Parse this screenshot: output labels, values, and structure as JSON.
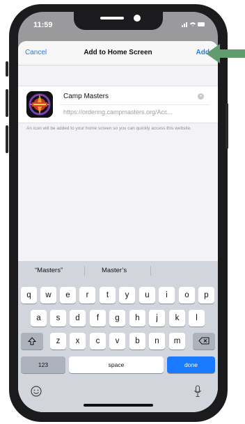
{
  "status": {
    "time": "11:59"
  },
  "nav": {
    "cancel": "Cancel",
    "title": "Add to Home Screen",
    "add": "Add"
  },
  "bookmark": {
    "name": "Camp Masters",
    "url": "https://ordering.campmasters.org/Acc...",
    "note": "An icon will be added to your home screen so you can quickly access this website."
  },
  "keyboard": {
    "suggestions": [
      "“Masters”",
      "Master’s"
    ],
    "row1": [
      "q",
      "w",
      "e",
      "r",
      "t",
      "y",
      "u",
      "i",
      "o",
      "p"
    ],
    "row2": [
      "a",
      "s",
      "d",
      "f",
      "g",
      "h",
      "j",
      "k",
      "l"
    ],
    "row3": [
      "z",
      "x",
      "c",
      "v",
      "b",
      "n",
      "m"
    ],
    "numbers": "123",
    "space": "space",
    "done": "done"
  },
  "colors": {
    "accent": "#1a7aff",
    "arrow": "#5f9c6e"
  }
}
